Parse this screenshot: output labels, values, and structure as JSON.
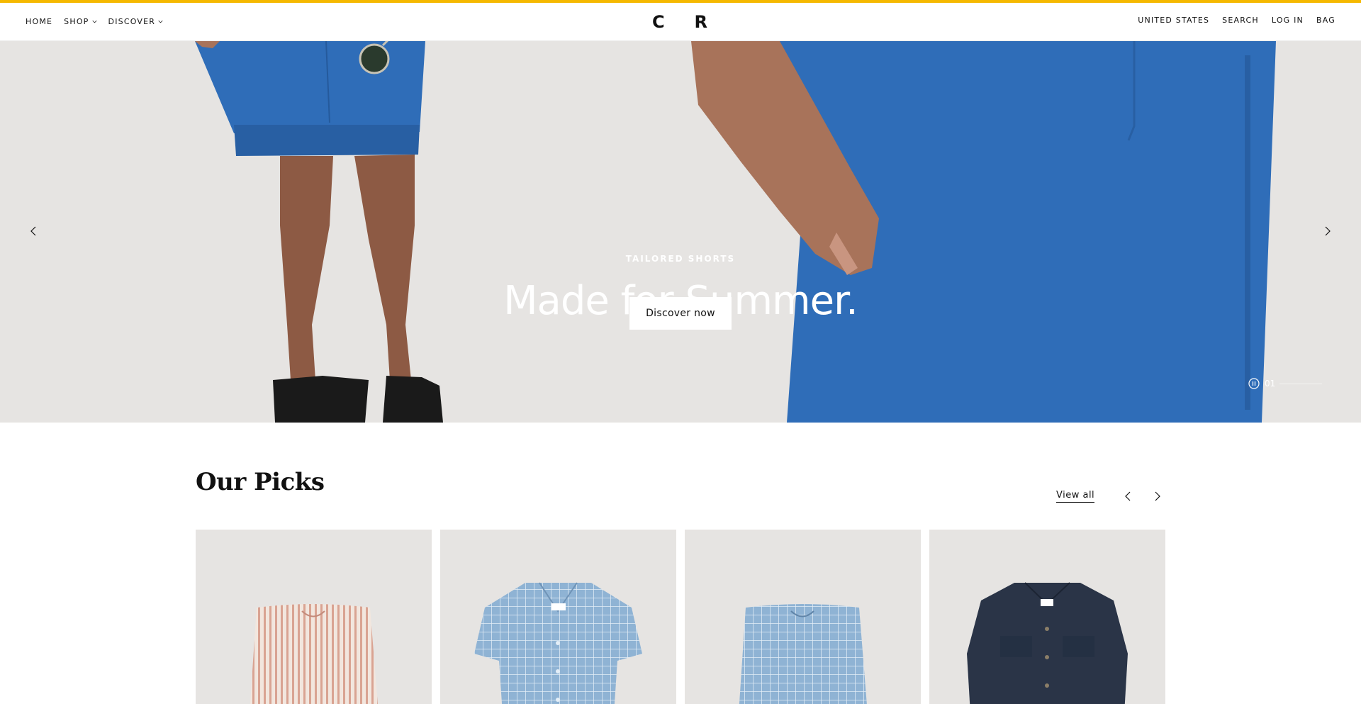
{
  "colors": {
    "accent_bar": "#f5b800",
    "hero_bg": "#e6e4e2",
    "garment_blue": "#2f6db8",
    "card_bg": "#e6e4e2"
  },
  "header": {
    "logo_left": "C",
    "logo_right": "R",
    "nav_left": [
      {
        "label": "HOME",
        "has_dropdown": false
      },
      {
        "label": "SHOP",
        "has_dropdown": true
      },
      {
        "label": "DISCOVER",
        "has_dropdown": true
      }
    ],
    "nav_right": [
      {
        "label": "UNITED STATES"
      },
      {
        "label": "SEARCH"
      },
      {
        "label": "LOG IN"
      },
      {
        "label": "BAG"
      }
    ]
  },
  "hero": {
    "eyebrow": "TAILORED SHORTS",
    "title": "Made for Summer.",
    "cta_label": "Discover now",
    "slide_index": "01",
    "icons": {
      "prev": "chevron-left-icon",
      "next": "chevron-right-icon",
      "pause": "pause-circle-icon"
    }
  },
  "picks": {
    "title": "Our Picks",
    "view_all_label": "View all",
    "icons": {
      "prev": "chevron-left-icon",
      "next": "chevron-right-icon"
    },
    "products": [
      {
        "kind": "striped-shorts",
        "color": "#d9a392"
      },
      {
        "kind": "check-shirt",
        "color": "#8fb3d4"
      },
      {
        "kind": "check-shorts",
        "color": "#8fb3d4"
      },
      {
        "kind": "overshirt",
        "color": "#2a3447"
      }
    ]
  }
}
